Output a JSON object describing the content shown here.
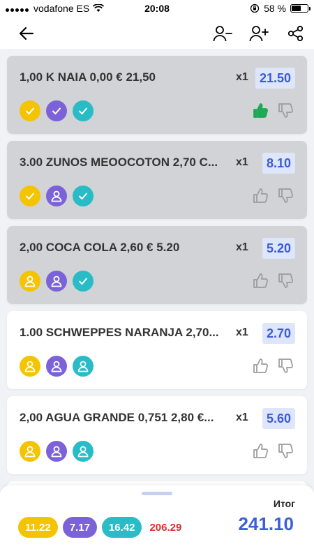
{
  "status_bar": {
    "carrier": "vodafone ES",
    "time": "20:08",
    "battery": "58 %",
    "battery_level": 0.58
  },
  "nav": {
    "back_icon": "arrow-left-icon",
    "actions": [
      "remove-person-icon",
      "add-person-icon",
      "share-icon"
    ]
  },
  "colors": {
    "person_1": "#f5c400",
    "person_2": "#7c62d9",
    "person_3": "#29bcc7",
    "price_bg": "#dde6fb",
    "price_text": "#3b5bd6",
    "thumbs_up_active": "#1fa855",
    "done_card": "#d2d3d6",
    "remaining": "#e02b2b"
  },
  "items": [
    {
      "name": "1,00 K NAIA 0,00 € 21,50",
      "qty": "x1",
      "price": "21.50",
      "done": true,
      "people": [
        "check",
        "check",
        "check"
      ],
      "vote": "up"
    },
    {
      "name": "3.00 ZUNOS MEOOCOTON 2,70 C...",
      "qty": "x1",
      "price": "8.10",
      "done": true,
      "people": [
        "check",
        "user",
        "check"
      ],
      "vote": "none"
    },
    {
      "name": "2,00 COCA COLA 2,60 € 5.20",
      "qty": "x1",
      "price": "5.20",
      "done": true,
      "people": [
        "user",
        "user",
        "check"
      ],
      "vote": "none"
    },
    {
      "name": "1.00 SCHWEPPES NARANJA 2,70...",
      "qty": "x1",
      "price": "2.70",
      "done": false,
      "people": [
        "user",
        "user",
        "user"
      ],
      "vote": "none"
    },
    {
      "name": "2,00 AGUA GRANDE 0,751 2,80 €...",
      "qty": "x1",
      "price": "5.60",
      "done": false,
      "people": [
        "user",
        "user",
        "user"
      ],
      "vote": "none"
    }
  ],
  "summary": {
    "total_label": "Итог",
    "person_totals": [
      "11.22",
      "7.17",
      "16.42"
    ],
    "remaining": "206.29",
    "grand_total": "241.10"
  }
}
